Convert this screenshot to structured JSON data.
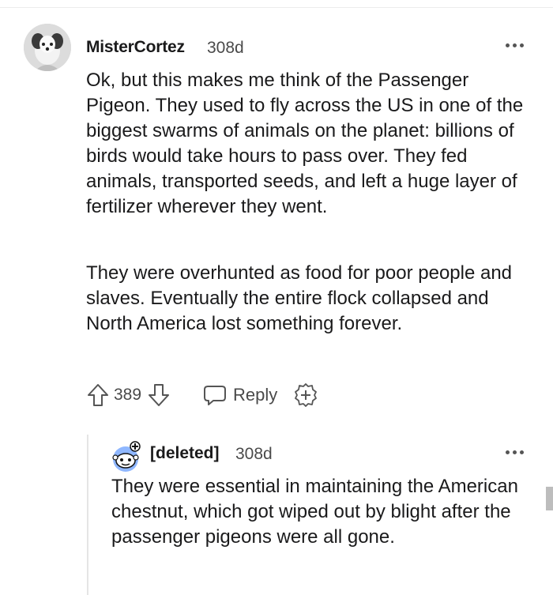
{
  "comment": {
    "author": "MisterCortez",
    "age": "308d",
    "paragraphs": [
      "Ok, but this makes me think of the Passenger Pigeon. They used to fly across the US in one of the biggest swarms of animals on the planet: billions of birds would take hours to pass over. They fed animals, transported seeds, and left a huge layer of fertilizer wherever they went.",
      "They were overhunted as food for poor people and slaves. Eventually the entire flock collapsed and North America lost something forever."
    ],
    "votes": "389",
    "reply_label": "Reply",
    "icons": {
      "more": "more-horizontal-icon",
      "upvote": "arrow-up-icon",
      "downvote": "arrow-down-icon",
      "reply": "speech-bubble-icon",
      "award": "award-plus-icon"
    }
  },
  "reply": {
    "author": "[deleted]",
    "age": "308d",
    "text": "They were essential in maintaining the American chestnut, which got wiped out by blight after the passenger pigeons were all gone.",
    "icons": {
      "avatar": "snoo-avatar-icon",
      "more": "more-horizontal-icon"
    }
  },
  "colors": {
    "text": "#1a1a1b",
    "muted": "#4a4a4a",
    "thread_line": "#e5e5e5"
  }
}
